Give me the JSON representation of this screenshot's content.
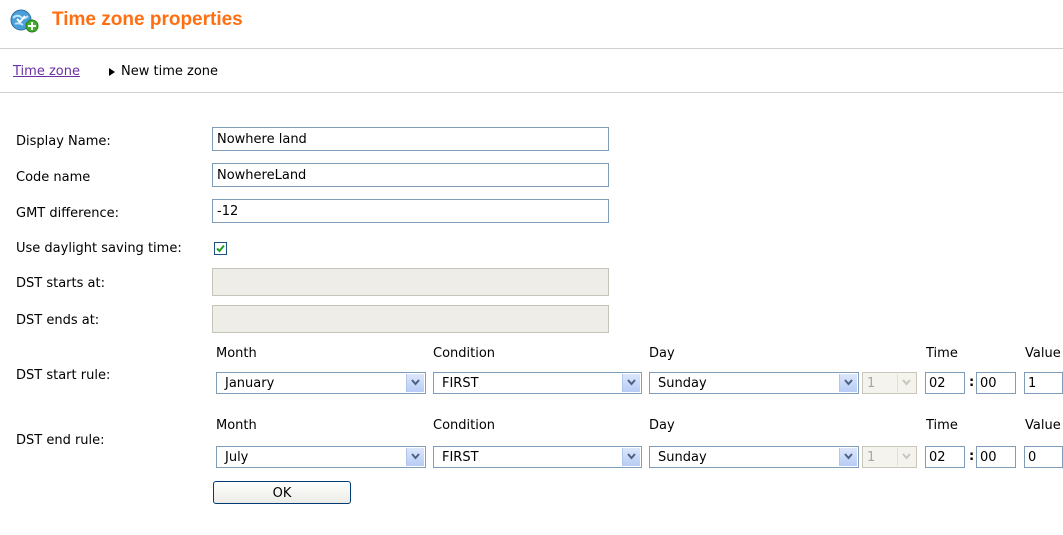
{
  "header": {
    "title": "Time zone properties",
    "icon": "globe-add-icon"
  },
  "breadcrumb": {
    "link": "Time zone",
    "current": "New time zone"
  },
  "form": {
    "display_name_label": "Display Name:",
    "display_name_value": "Nowhere land",
    "code_name_label": "Code name",
    "code_name_value": "NowhereLand",
    "gmt_label": "GMT difference:",
    "gmt_value": "-12",
    "dst_use_label": "Use daylight saving time:",
    "dst_use_checked": true,
    "dst_starts_label": "DST starts at:",
    "dst_starts_value": "",
    "dst_ends_label": "DST ends at:",
    "dst_ends_value": ""
  },
  "rules": {
    "columns": {
      "month": "Month",
      "condition": "Condition",
      "day": "Day",
      "time": "Time",
      "value": "Value"
    },
    "start": {
      "label": "DST start rule:",
      "month": "January",
      "condition": "FIRST",
      "day": "Sunday",
      "day_number": "1",
      "hour": "02",
      "minute": "00",
      "value": "1"
    },
    "end": {
      "label": "DST end rule:",
      "month": "July",
      "condition": "FIRST",
      "day": "Sunday",
      "day_number": "1",
      "hour": "02",
      "minute": "00",
      "value": "0"
    }
  },
  "actions": {
    "ok_label": "OK"
  },
  "colors": {
    "title": "#ff6f12",
    "link": "#6a2fa0",
    "input_border": "#7f9db9"
  }
}
